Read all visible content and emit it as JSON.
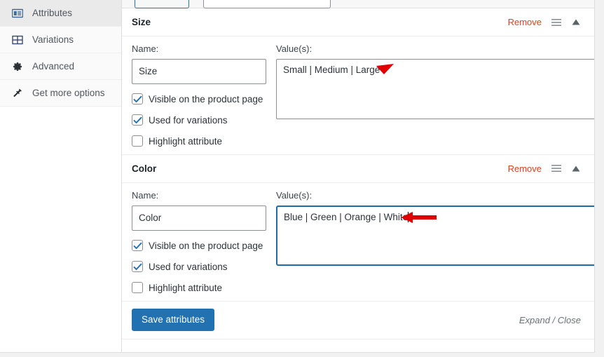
{
  "sidebar": {
    "items": [
      {
        "label": "Attributes",
        "icon": "attributes-icon",
        "active": true
      },
      {
        "label": "Variations",
        "icon": "variations-icon",
        "active": false
      },
      {
        "label": "Advanced",
        "icon": "gear-icon",
        "active": false
      },
      {
        "label": "Get more options",
        "icon": "plug-icon",
        "active": false
      }
    ]
  },
  "toolbar": {
    "add_button_label": "",
    "select_value": ""
  },
  "labels": {
    "name": "Name:",
    "values": "Value(s):",
    "remove": "Remove",
    "visible_on_product_page": "Visible on the product page",
    "used_for_variations": "Used for variations",
    "highlight_attribute": "Highlight attribute",
    "drag_handle_icon": "drag-handle-icon",
    "collapse_icon": "collapse-up-icon"
  },
  "attributes": [
    {
      "title": "Size",
      "name_value": "Size",
      "values_value": "Small | Medium | Large",
      "focused": false,
      "visible_checked": true,
      "variations_checked": true,
      "highlight_checked": false
    },
    {
      "title": "Color",
      "name_value": "Color",
      "values_value": "Blue | Green | Orange | White",
      "focused": true,
      "visible_checked": true,
      "variations_checked": true,
      "highlight_checked": false
    }
  ],
  "footer": {
    "save_label": "Save attributes",
    "expand_close_label": "Expand / Close"
  },
  "annotations": [
    {
      "name": "size-values-arrow",
      "color": "#e00000"
    },
    {
      "name": "color-values-arrow",
      "color": "#e00000"
    }
  ],
  "colors": {
    "accent": "#2271b1",
    "remove_link": "#e2401c",
    "annotation": "#e00000",
    "focus_border": "#1d6ca3",
    "page_background": "#f1f1f1"
  }
}
